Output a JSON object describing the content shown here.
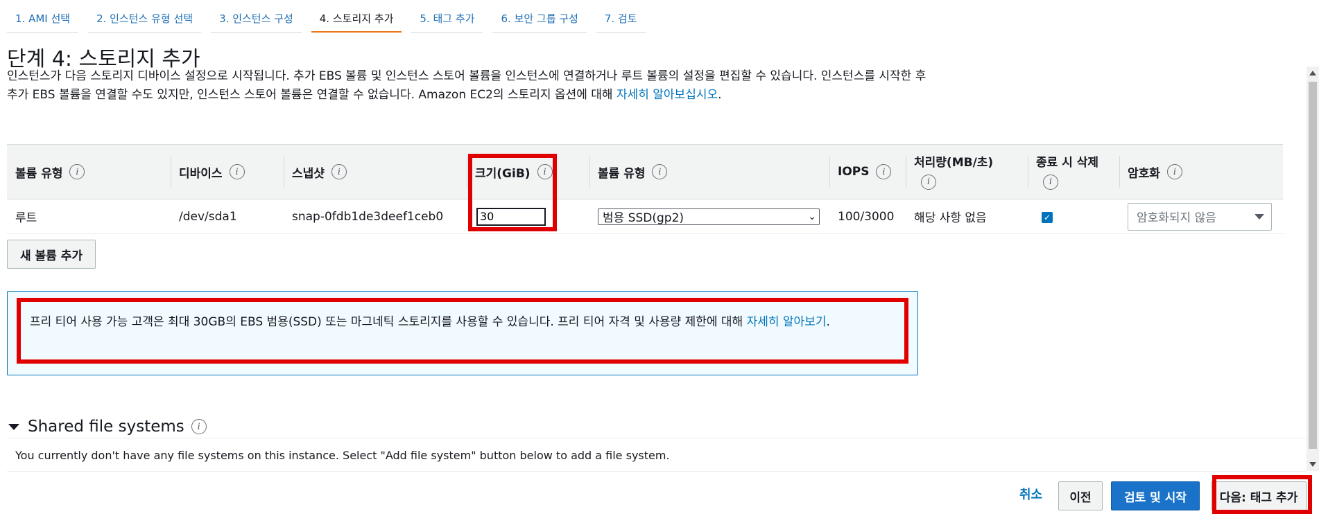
{
  "wizard": {
    "steps": [
      {
        "label": "1. AMI 선택"
      },
      {
        "label": "2. 인스턴스 유형 선택"
      },
      {
        "label": "3. 인스턴스 구성"
      },
      {
        "label": "4. 스토리지 추가"
      },
      {
        "label": "5. 태그 추가"
      },
      {
        "label": "6. 보안 그룹 구성"
      },
      {
        "label": "7. 검토"
      }
    ],
    "active_step": 3
  },
  "page": {
    "title": "단계 4: 스토리지 추가",
    "description": "인스턴스가 다음 스토리지 디바이스 설정으로 시작됩니다. 추가 EBS 볼륨 및 인스턴스 스토어 볼륨을 인스턴스에 연결하거나 루트 볼륨의 설정을 편집할 수 있습니다. 인스턴스를 시작한 후 추가 EBS 볼륨을 연결할 수도 있지만, 인스턴스 스토어 볼륨은 연결할 수 없습니다. Amazon EC2의 스토리지 옵션에 대해 ",
    "description_link": "자세히 알아보십시오",
    "description_end": "."
  },
  "table": {
    "headers": {
      "volume_category": "볼륨 유형",
      "device": "디바이스",
      "snapshot": "스냅샷",
      "size": "크기(GiB)",
      "volume_type": "볼륨 유형",
      "iops": "IOPS",
      "throughput": "처리량(MB/초)",
      "delete_on_termination": "종료 시 삭제",
      "encryption": "암호화"
    },
    "rows": [
      {
        "volume_category": "루트",
        "device": "/dev/sda1",
        "snapshot": "snap-0fdb1de3deef1ceb0",
        "size": "30",
        "volume_type": "범용 SSD(gp2)",
        "iops": "100/3000",
        "throughput": "해당 사항 없음",
        "delete_on_termination": true,
        "encryption": "암호화되지 않음"
      }
    ],
    "add_volume_label": "새 볼륨 추가"
  },
  "free_tier": {
    "text": "프리 티어 사용 가능 고객은 최대 30GB의 EBS 범용(SSD) 또는 마그네틱 스토리지를 사용할 수 있습니다. 프리 티어 자격 및 사용량 제한에 대해 ",
    "link": "자세히 알아보기",
    "end": "."
  },
  "shared_fs": {
    "title": "Shared file systems",
    "body": "You currently don't have any file systems on this instance. Select \"Add file system\" button below to add a file system."
  },
  "footer": {
    "cancel": "취소",
    "previous": "이전",
    "review_launch": "검토 및 시작",
    "next": "다음: 태그 추가"
  },
  "colors": {
    "accent": "#0073bb",
    "primary_button": "#1a73c9",
    "highlight": "#e00000",
    "active_tab_underline": "#ec7211"
  }
}
